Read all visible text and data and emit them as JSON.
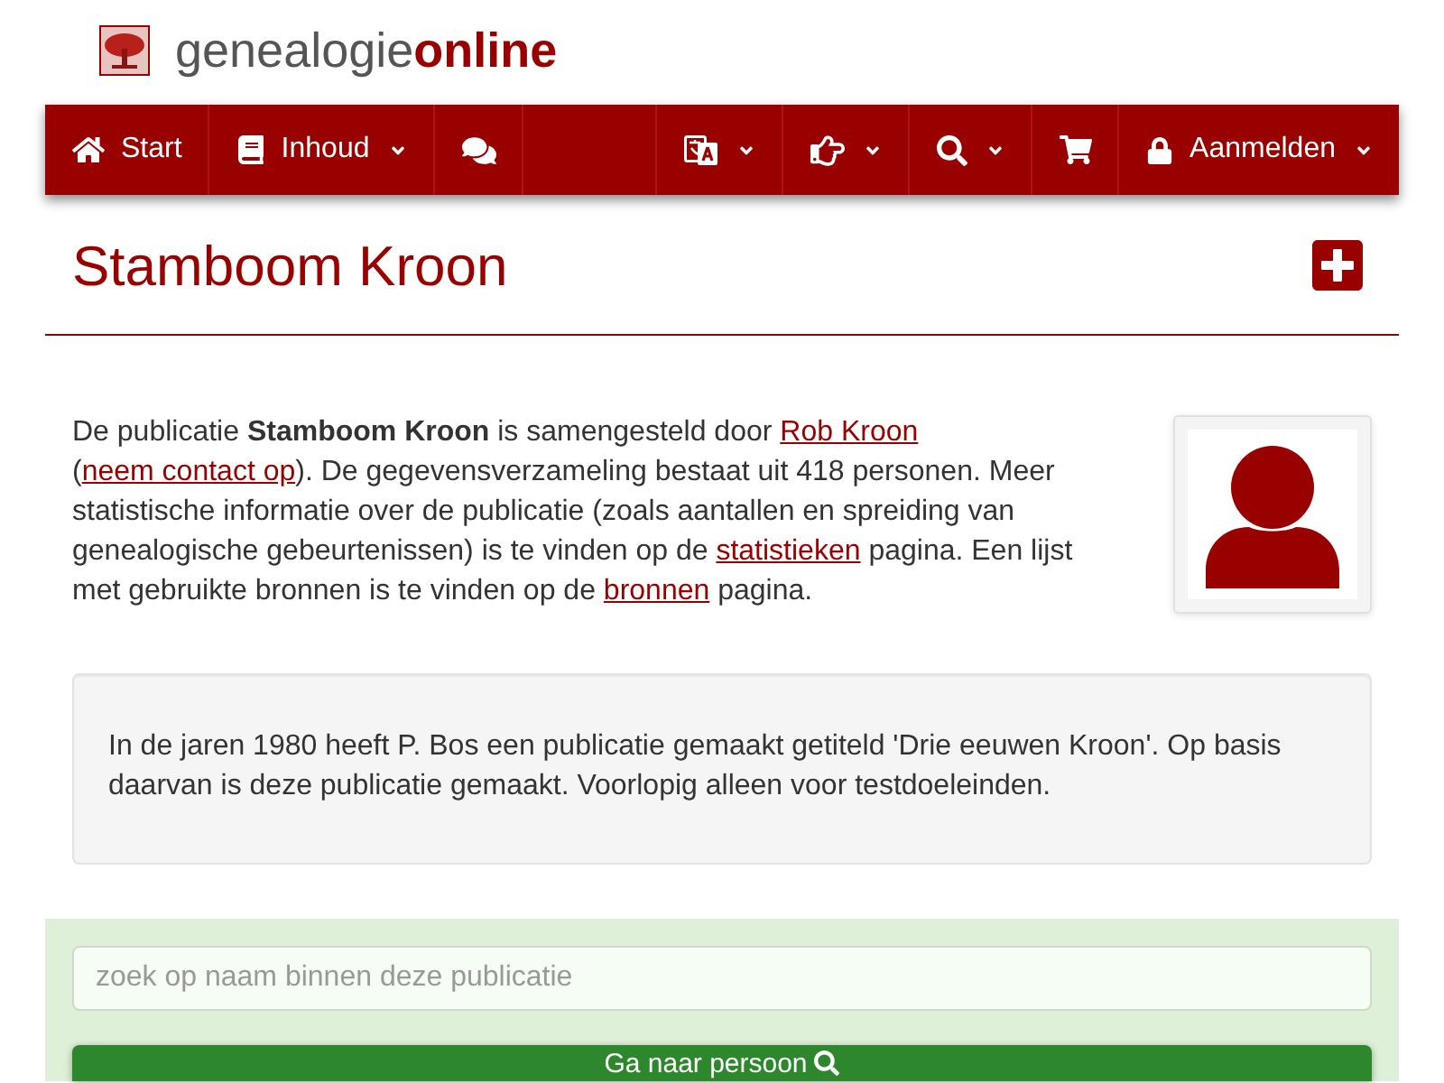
{
  "site_logo": {
    "text": "genealogie**online**"
  },
  "nav": {
    "left": [
      {
        "kind": "home",
        "label": "Start",
        "dropdown": false
      },
      {
        "kind": "book",
        "label": "Inhoud",
        "dropdown": true
      },
      {
        "kind": "comments",
        "dropdown": false
      }
    ],
    "right": [
      {
        "kind": "language",
        "dropdown": true
      },
      {
        "kind": "hand",
        "dropdown": true
      },
      {
        "kind": "search",
        "dropdown": true
      },
      {
        "kind": "cart",
        "dropdown": false
      },
      {
        "kind": "lock",
        "label": "Aanmelden",
        "dropdown": true
      }
    ]
  },
  "page_title": "Stamboom Kroon",
  "intro": [
    {
      "kind": "text",
      "text": "De publicatie **Stamboom Kroon** is samengesteld door "
    },
    {
      "kind": "link",
      "text": "Rob Kroon"
    },
    {
      "kind": "text",
      "text": " ("
    },
    {
      "kind": "link",
      "text": "neem contact op"
    },
    {
      "kind": "text",
      "text": "). De gegevensverzameling bestaat uit 418 personen. Meer statistische informatie over de publicatie (zoals aantallen en spreiding van genealogische gebeurtenissen) is te vinden op de "
    },
    {
      "kind": "link",
      "text": "statistieken"
    },
    {
      "kind": "text",
      "text": " pagina. Een lijst met gebruikte bronnen is te vinden op de "
    },
    {
      "kind": "link",
      "text": "bronnen"
    },
    {
      "kind": "text",
      "text": " pagina."
    }
  ],
  "note": "In de jaren 1980 heeft P. Bos een publicatie gemaakt getiteld 'Drie eeuwen Kroon'. Op basis daarvan is deze publicatie gemaakt. Voorlopig alleen voor testdoeleinden.",
  "search": {
    "placeholder": "zoek op naam binnen deze publicatie",
    "button": "Ga naar persoon"
  }
}
